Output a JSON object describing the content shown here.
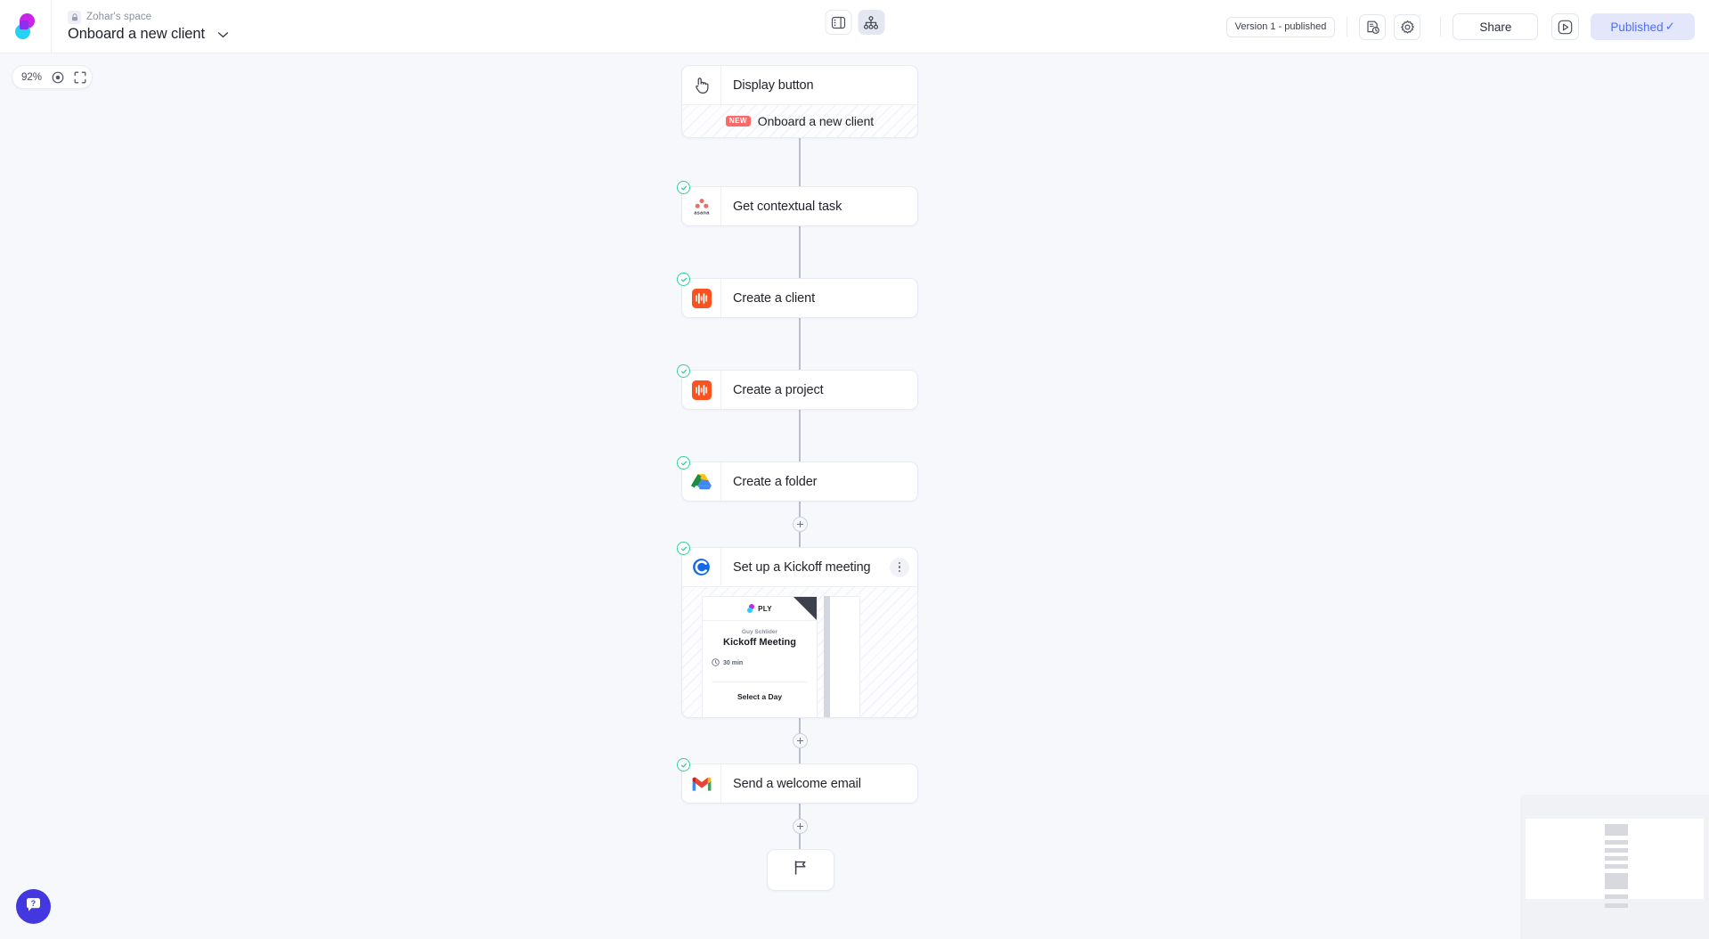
{
  "app": {
    "logo_icon": "ply-logo-icon",
    "space_name": "Zohar's space",
    "lock_icon": "lock-icon",
    "flow_name": "Onboard a new client",
    "chevron_icon": "chevron-down-icon"
  },
  "toolbar": {
    "panel_toggle_icon": "sidebar-panel-icon",
    "flow_view_icon": "flow-hierarchy-icon",
    "version_label": "Version 1 - published",
    "history_icon": "version-history-icon",
    "settings_icon": "gear-icon",
    "share_label": "Share",
    "run_icon": "play-icon",
    "published_label": "Published",
    "published_check": "✓",
    "accent_published_bg": "#e4e7fb",
    "accent_published_fg": "#4f6ef7"
  },
  "zoom_control": {
    "level": "92%",
    "center_icon": "center-target-icon",
    "fit_icon": "fit-screen-icon"
  },
  "flow": {
    "nodes": [
      {
        "id": "display-button",
        "icon": "tap-cursor-icon",
        "title": "Display button",
        "has_check": false,
        "body": {
          "type": "hatched",
          "badge": "NEW",
          "badge_color": "#fa6a6a",
          "label": "Onboard a new client"
        }
      },
      {
        "id": "get-contextual-task",
        "icon": "asana-icon",
        "title": "Get contextual task",
        "has_check": true
      },
      {
        "id": "create-a-client",
        "icon": "harvest-icon",
        "title": "Create a client",
        "has_check": true
      },
      {
        "id": "create-a-project",
        "icon": "harvest-icon",
        "title": "Create a project",
        "has_check": true
      },
      {
        "id": "create-a-folder",
        "icon": "google-drive-icon",
        "title": "Create a folder",
        "has_check": true
      },
      {
        "id": "set-up-kickoff-meeting",
        "icon": "calendly-icon",
        "title": "Set up a Kickoff meeting",
        "has_check": true,
        "menu_icon": "kebab-menu-icon",
        "preview": {
          "brand": "PLY",
          "host": "Guy Schlider",
          "title": "Kickoff Meeting",
          "duration_icon": "clock-icon",
          "duration": "30 min",
          "select_label": "Select a Day"
        }
      },
      {
        "id": "send-a-welcome-email",
        "icon": "gmail-icon",
        "title": "Send a welcome email",
        "has_check": true
      }
    ],
    "end_node": {
      "icon": "flag-icon"
    },
    "add_button_icon": "plus-icon"
  },
  "minimap": {
    "label": "minimap"
  },
  "help": {
    "icon": "help-question-icon",
    "color": "#4338e0"
  }
}
